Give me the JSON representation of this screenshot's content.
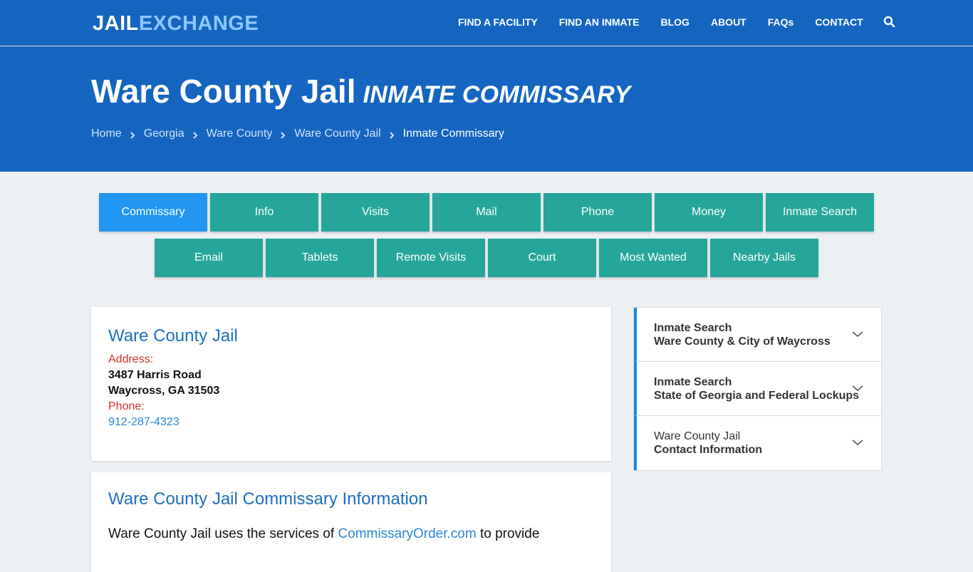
{
  "header": {
    "logo_part1": "JAIL",
    "logo_part2": "EXCHANGE",
    "nav": [
      "FIND A FACILITY",
      "FIND AN INMATE",
      "BLOG",
      "ABOUT",
      "FAQs",
      "CONTACT"
    ],
    "search_icon": "search-icon"
  },
  "hero": {
    "title": "Ware County Jail",
    "subtitle": "INMATE COMMISSARY",
    "breadcrumbs": [
      "Home",
      "Georgia",
      "Ware County",
      "Ware County Jail"
    ],
    "current": "Inmate Commissary"
  },
  "tabs": {
    "row1": [
      "Commissary",
      "Info",
      "Visits",
      "Mail",
      "Phone",
      "Money",
      "Inmate Search"
    ],
    "row2": [
      "Email",
      "Tablets",
      "Remote Visits",
      "Court",
      "Most Wanted",
      "Nearby Jails"
    ],
    "active": "Commissary"
  },
  "facility": {
    "name": "Ware County Jail",
    "address_label": "Address:",
    "street": "3487 Harris Road",
    "city": "Waycross, GA 31503",
    "phone_label": "Phone:",
    "phone": "912-287-4323"
  },
  "commissary": {
    "title": "Ware County Jail Commissary Information",
    "text_before": "Ware County Jail uses the services of ",
    "link": "CommissaryOrder.com",
    "text_after": " to provide"
  },
  "sidebar": {
    "items": [
      {
        "line1": "Inmate Search",
        "line2": "Ware County & City of Waycross"
      },
      {
        "line1": "Inmate Search",
        "line2": "State of Georgia and Federal Lockups"
      },
      {
        "line1": "Ware County Jail",
        "line2": "Contact Information"
      }
    ]
  },
  "colors": {
    "header_blue": "#1565c0",
    "tab_teal": "#26a69a",
    "tab_active": "#2196f3",
    "label_red": "#d32f2f",
    "link_blue": "#2b86d6"
  }
}
